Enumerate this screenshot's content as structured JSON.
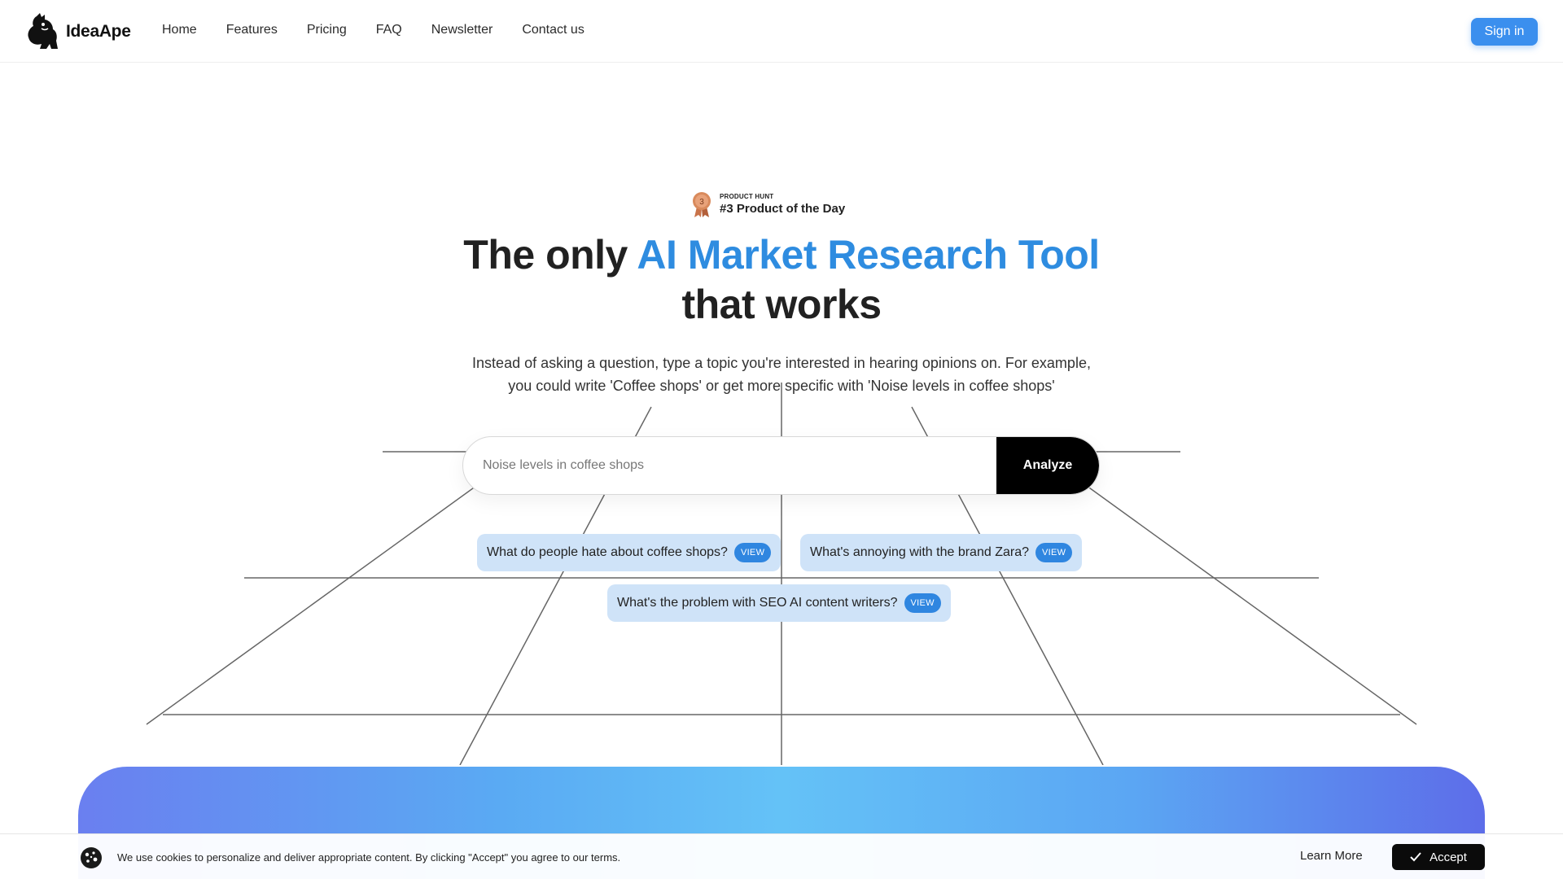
{
  "header": {
    "brand": "IdeaApe",
    "nav": [
      {
        "label": "Home"
      },
      {
        "label": "Features"
      },
      {
        "label": "Pricing"
      },
      {
        "label": "FAQ"
      },
      {
        "label": "Newsletter"
      },
      {
        "label": "Contact us"
      }
    ],
    "signin_label": "Sign in"
  },
  "badge": {
    "source": "PRODUCT HUNT",
    "rank_number": "3",
    "title": "#3 Product of the Day"
  },
  "hero": {
    "headline_pre": "The only ",
    "headline_accent": "AI Market Research Tool",
    "headline_post": "that works",
    "subtext_line1": "Instead of asking a question, type a topic you're interested in hearing opinions on. For example,",
    "subtext_line2": "you could write 'Coffee shops' or get more specific with 'Noise levels in coffee shops'"
  },
  "search": {
    "placeholder": "Noise levels in coffee shops",
    "value": "",
    "button_label": "Analyze"
  },
  "suggestions": [
    {
      "text": "What do people hate about coffee shops?",
      "action": "VIEW"
    },
    {
      "text": "What's annoying with the brand Zara?",
      "action": "VIEW"
    },
    {
      "text": "What's the problem with SEO AI content writers?",
      "action": "VIEW"
    }
  ],
  "cookie": {
    "message": "We use cookies to personalize and deliver appropriate content. By clicking \"Accept\" you agree to our terms.",
    "learn_more": "Learn More",
    "accept": "Accept"
  },
  "colors": {
    "accent": "#2e8ce0",
    "signin": "#3b8fee",
    "chip_bg": "#cfe3f8",
    "view_badge": "#2f86e0",
    "analyze_bg": "#000000"
  },
  "icons": [
    "ape-logo-icon",
    "medal-icon",
    "cookie-icon",
    "check-icon"
  ]
}
